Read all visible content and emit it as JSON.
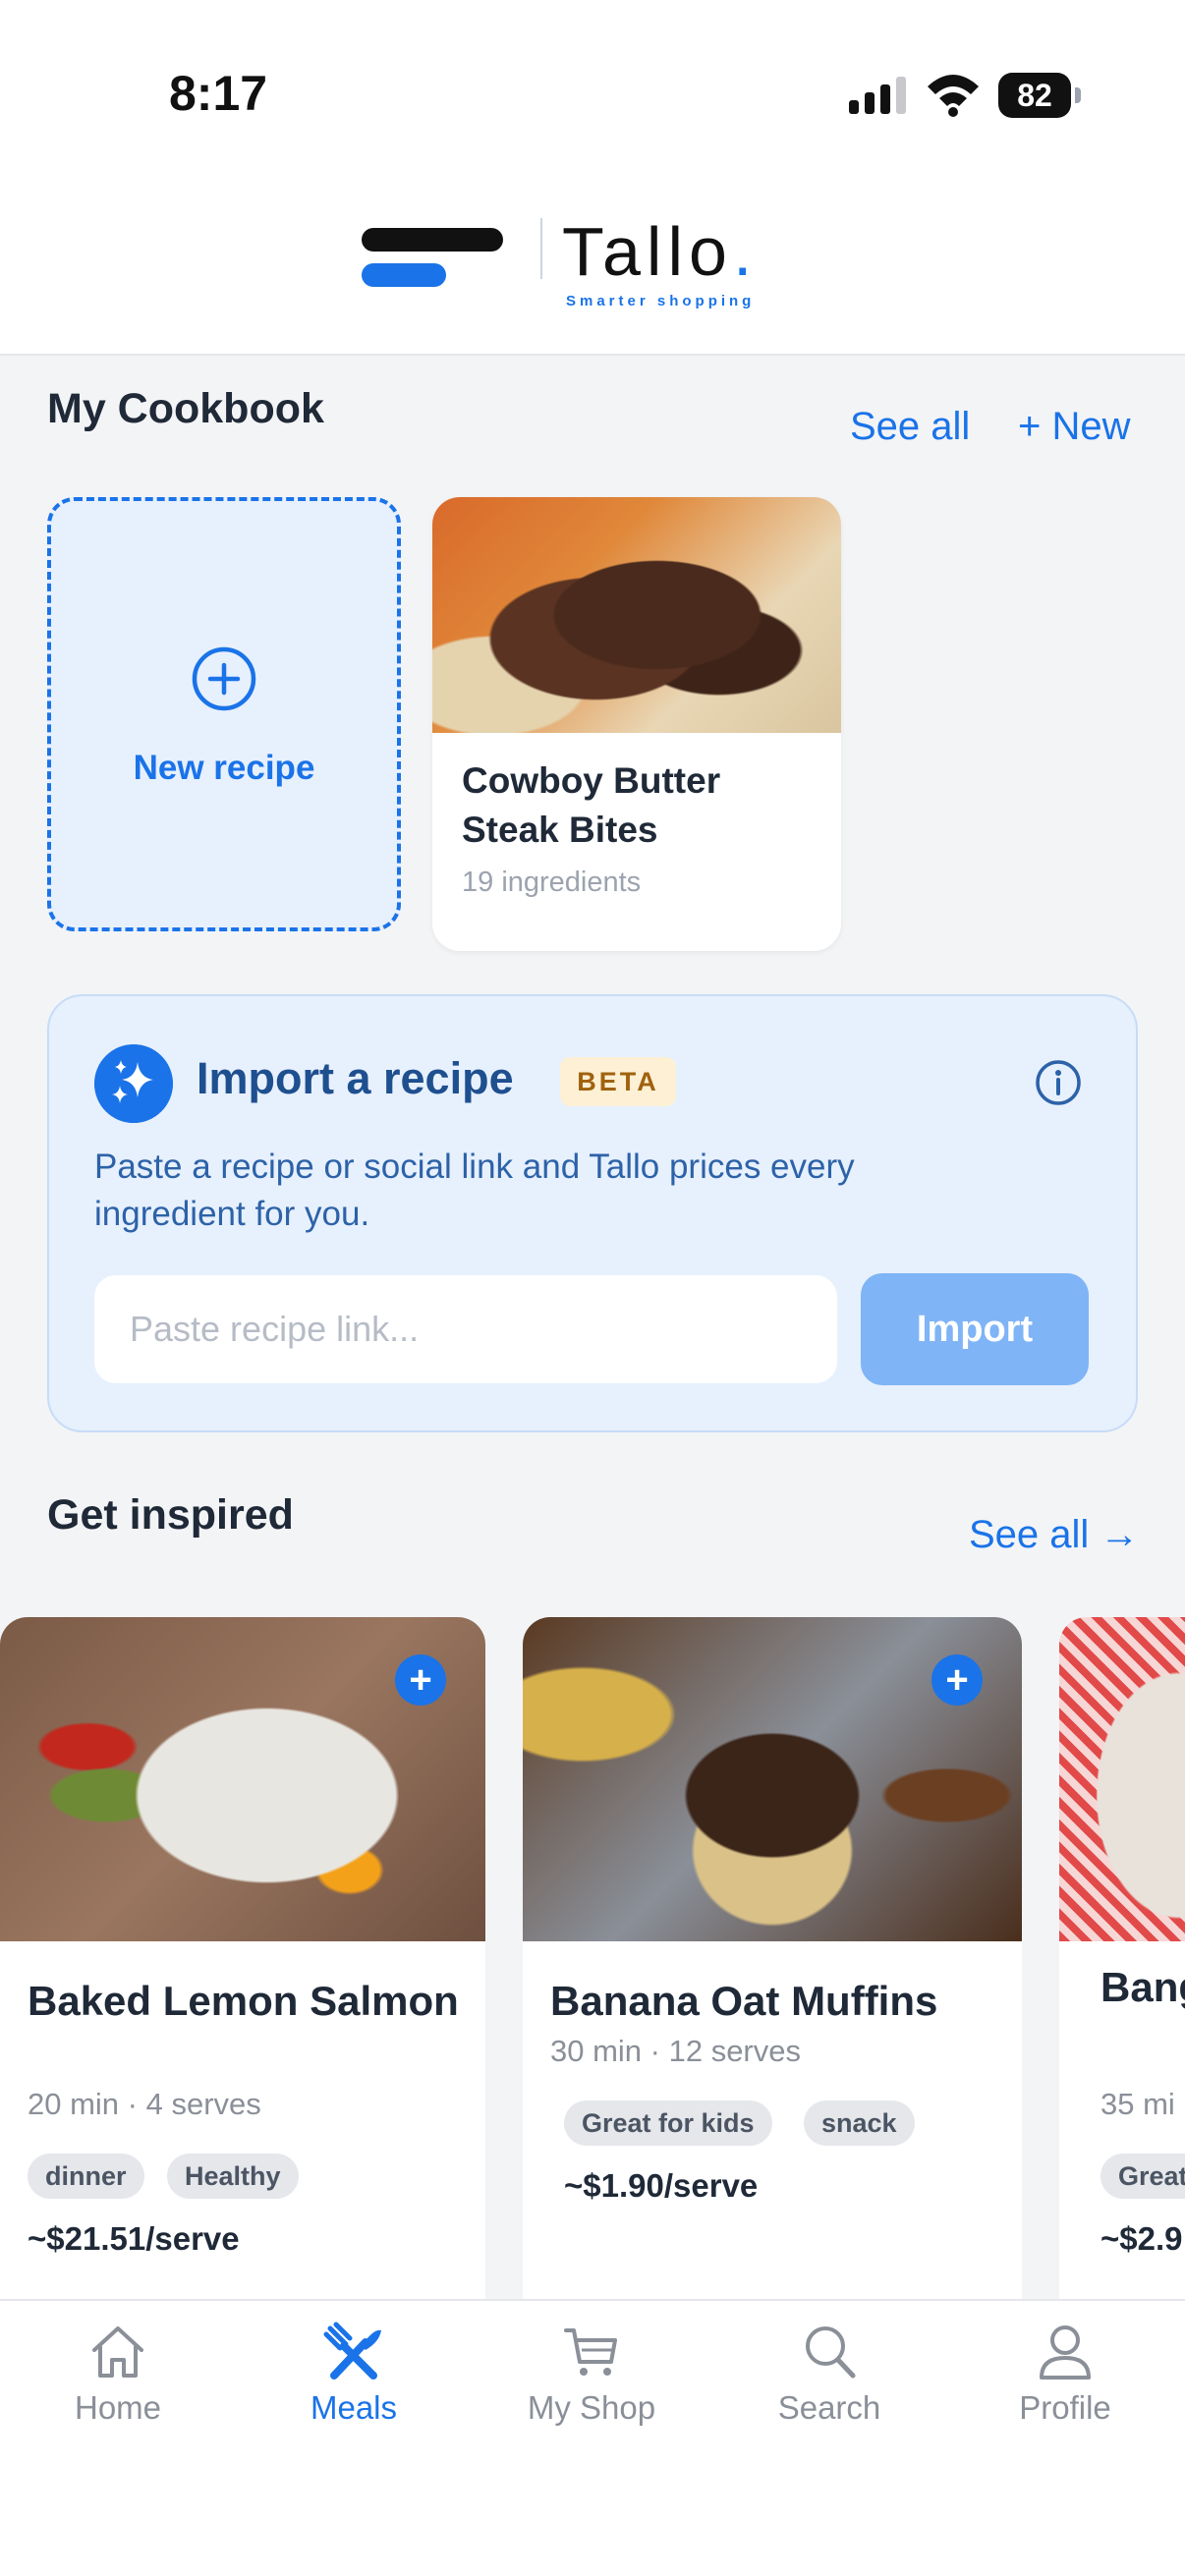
{
  "status_bar": {
    "time": "8:17",
    "battery": "82"
  },
  "header": {
    "brand": "Tallo",
    "brand_dot": ".",
    "tagline": "Smarter shopping"
  },
  "cookbook": {
    "title": "My Cookbook",
    "see_all": "See all",
    "new": "+ New",
    "new_recipe_label": "New recipe",
    "recipes": [
      {
        "title": "Cowboy Butter Steak Bites",
        "meta": "19 ingredients"
      }
    ]
  },
  "import": {
    "title": "Import a recipe",
    "badge": "BETA",
    "description": "Paste a recipe or social link and Tallo prices every ingredient for you.",
    "placeholder": "Paste recipe link...",
    "button": "Import"
  },
  "inspired": {
    "title": "Get inspired",
    "see_all": "See all →",
    "cards": [
      {
        "title": "Baked Lemon Salmon",
        "meta": "20 min · 4 serves",
        "tags": [
          "dinner",
          "Healthy"
        ],
        "price": "~$21.51/serve"
      },
      {
        "title": "Banana Oat Muffins",
        "meta": "30 min · 12 serves",
        "tags": [
          "Great for kids",
          "snack"
        ],
        "price": "~$1.90/serve"
      },
      {
        "title": "Bang with",
        "meta": "35 mi",
        "tags": [
          "Great"
        ],
        "price": "~$2.9"
      }
    ]
  },
  "nav": {
    "items": [
      {
        "label": "Home",
        "icon": "home-icon"
      },
      {
        "label": "Meals",
        "icon": "utensils-icon",
        "active": true
      },
      {
        "label": "My Shop",
        "icon": "cart-icon"
      },
      {
        "label": "Search",
        "icon": "search-icon"
      },
      {
        "label": "Profile",
        "icon": "profile-icon"
      }
    ]
  },
  "colors": {
    "accent": "#1a73e8",
    "background": "#f3f4f6",
    "import_panel": "#e7f0fd",
    "beta_badge": "#fdf0d5"
  }
}
